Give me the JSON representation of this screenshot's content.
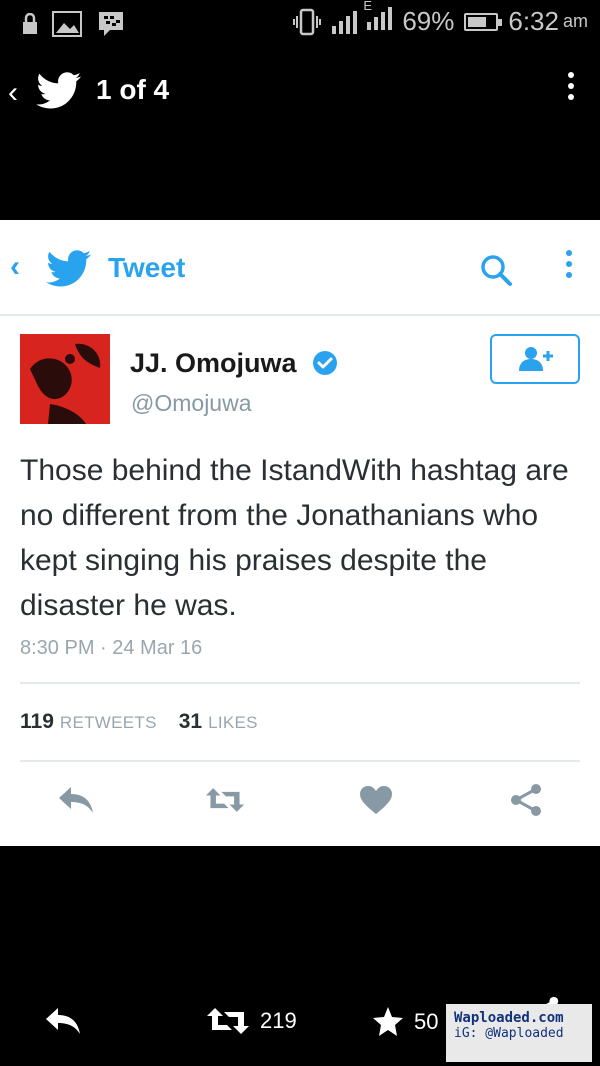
{
  "status_bar": {
    "battery": "69%",
    "time": "6:32",
    "ampm": "am",
    "signal_label": "E"
  },
  "gallery": {
    "counter": "1 of 4",
    "retweet_count": "219",
    "like_count": "50"
  },
  "tweet_header": {
    "title": "Tweet"
  },
  "tweet": {
    "author_name": "JJ. Omojuwa",
    "author_handle": "@Omojuwa",
    "text": "Those behind the IstandWith hashtag are no different from the Jonathanians who kept singing his praises despite the disaster he was.",
    "timestamp": "8:30 PM · 24 Mar 16",
    "retweets_count": "119",
    "retweets_label": "RETWEETS",
    "likes_count": "31",
    "likes_label": "LIKES"
  },
  "watermark": {
    "line1": "Waploaded.com",
    "line2": "iG: @Waploaded"
  },
  "colors": {
    "twitter_blue": "#2aa3ef",
    "avatar_red": "#d8241e",
    "action_gray": "#8899a6"
  },
  "icons": [
    "lock-icon",
    "image-icon",
    "bbm-icon",
    "vibrate-icon",
    "signal-icon",
    "battery-icon",
    "twitter-bird-icon",
    "kebab-icon",
    "search-icon",
    "verified-icon",
    "follow-icon",
    "reply-icon",
    "retweet-icon",
    "heart-icon",
    "share-icon",
    "star-icon"
  ]
}
